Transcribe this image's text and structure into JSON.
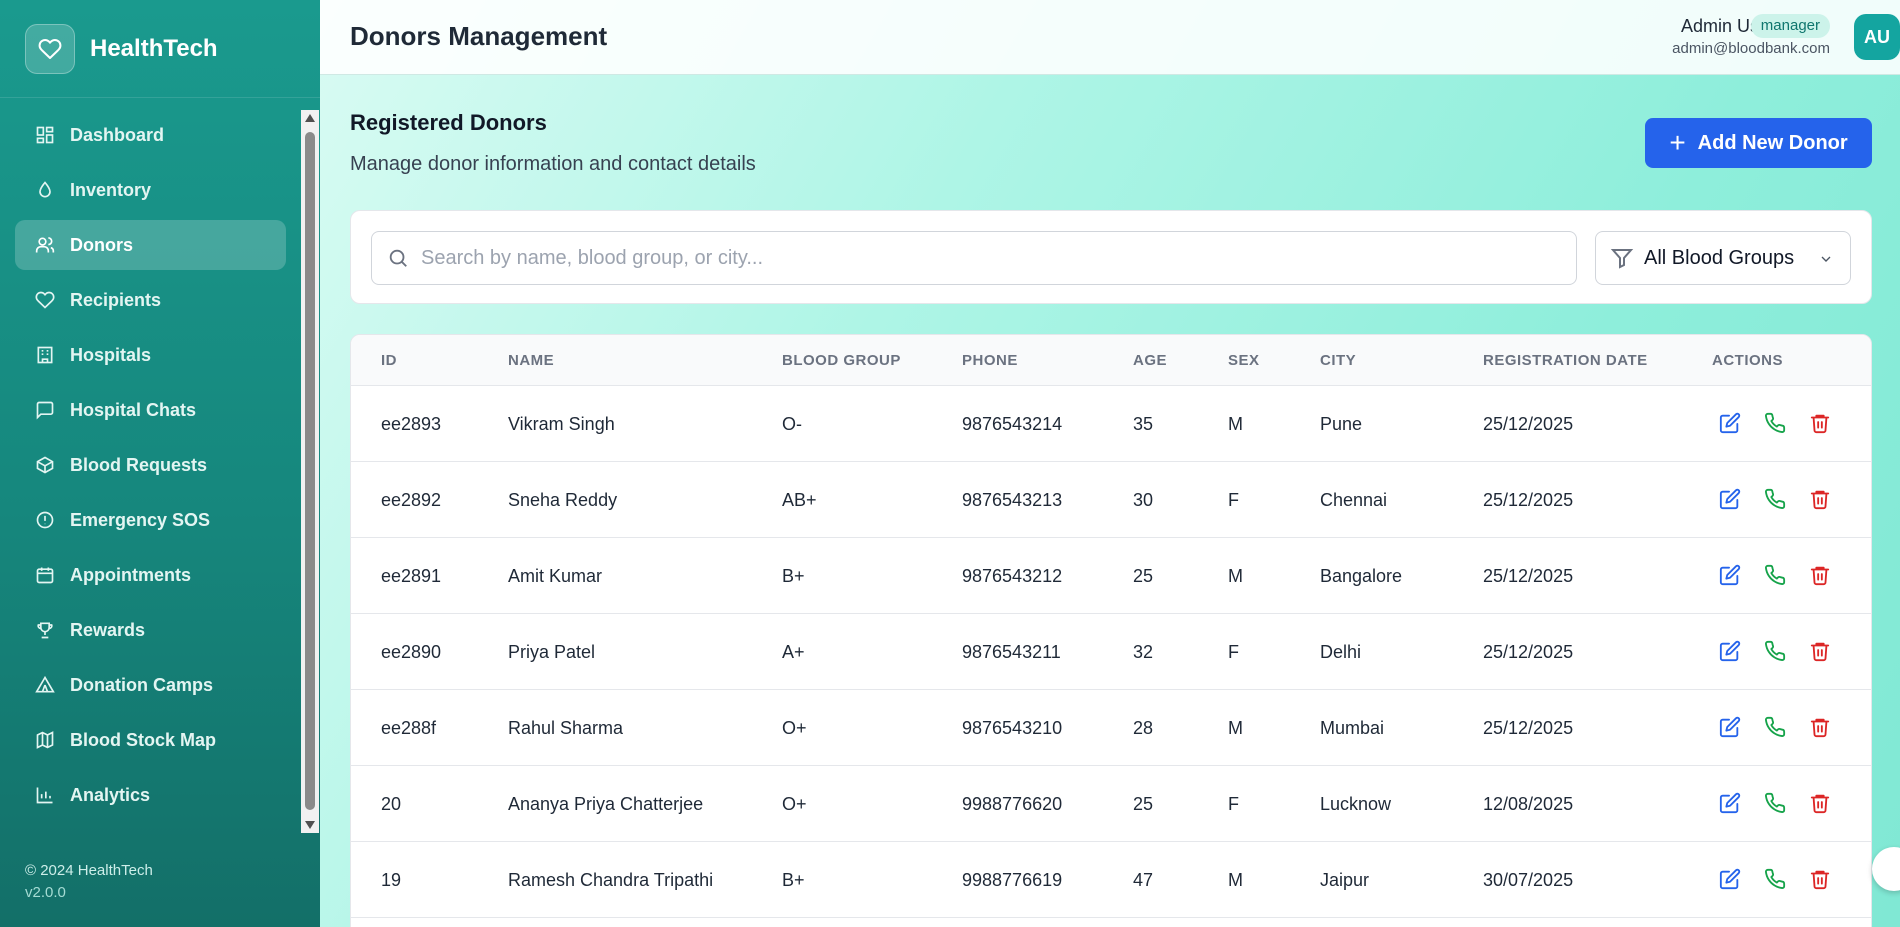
{
  "brand": {
    "name": "HealthTech",
    "logo_icon": "heart-icon"
  },
  "sidebar": {
    "items": [
      {
        "label": "Dashboard",
        "icon": "grid-icon"
      },
      {
        "label": "Inventory",
        "icon": "droplet-icon"
      },
      {
        "label": "Donors",
        "icon": "users-icon",
        "active": true
      },
      {
        "label": "Recipients",
        "icon": "heart-icon"
      },
      {
        "label": "Hospitals",
        "icon": "building-icon"
      },
      {
        "label": "Hospital Chats",
        "icon": "chat-icon"
      },
      {
        "label": "Blood Requests",
        "icon": "package-icon"
      },
      {
        "label": "Emergency SOS",
        "icon": "alert-circle-icon"
      },
      {
        "label": "Appointments",
        "icon": "calendar-icon"
      },
      {
        "label": "Rewards",
        "icon": "trophy-icon"
      },
      {
        "label": "Donation Camps",
        "icon": "tent-icon"
      },
      {
        "label": "Blood Stock Map",
        "icon": "map-icon"
      },
      {
        "label": "Analytics",
        "icon": "bar-chart-icon"
      }
    ],
    "footer_copyright": "© 2024 HealthTech",
    "footer_version": "v2.0.0"
  },
  "header": {
    "title": "Donors Management",
    "user_name": "Admin User",
    "user_role": "manager",
    "user_email": "admin@bloodbank.com",
    "avatar_initials": "AU"
  },
  "main": {
    "section_title": "Registered Donors",
    "section_subtitle": "Manage donor information and contact details",
    "add_button_label": "Add New Donor",
    "search_placeholder": "Search by name, blood group, or city...",
    "filter_selected": "All Blood Groups"
  },
  "table": {
    "columns": [
      "ID",
      "NAME",
      "BLOOD GROUP",
      "PHONE",
      "AGE",
      "SEX",
      "CITY",
      "REGISTRATION DATE",
      "ACTIONS"
    ],
    "rows": [
      [
        "ee2893",
        "Vikram Singh",
        "O-",
        "9876543214",
        "35",
        "M",
        "Pune",
        "25/12/2025"
      ],
      [
        "ee2892",
        "Sneha Reddy",
        "AB+",
        "9876543213",
        "30",
        "F",
        "Chennai",
        "25/12/2025"
      ],
      [
        "ee2891",
        "Amit Kumar",
        "B+",
        "9876543212",
        "25",
        "M",
        "Bangalore",
        "25/12/2025"
      ],
      [
        "ee2890",
        "Priya Patel",
        "A+",
        "9876543211",
        "32",
        "F",
        "Delhi",
        "25/12/2025"
      ],
      [
        "ee288f",
        "Rahul Sharma",
        "O+",
        "9876543210",
        "28",
        "M",
        "Mumbai",
        "25/12/2025"
      ],
      [
        "20",
        "Ananya Priya Chatterjee",
        "O+",
        "9988776620",
        "25",
        "F",
        "Lucknow",
        "12/08/2025"
      ],
      [
        "19",
        "Ramesh Chandra Tripathi",
        "B+",
        "9988776619",
        "47",
        "M",
        "Jaipur",
        "30/07/2025"
      ]
    ]
  },
  "colors": {
    "sidebar_bg": "#16877d",
    "accent": "#2563eb",
    "edit_icon": "#2563eb",
    "call_icon": "#16a34a",
    "delete_icon": "#dc2626"
  }
}
